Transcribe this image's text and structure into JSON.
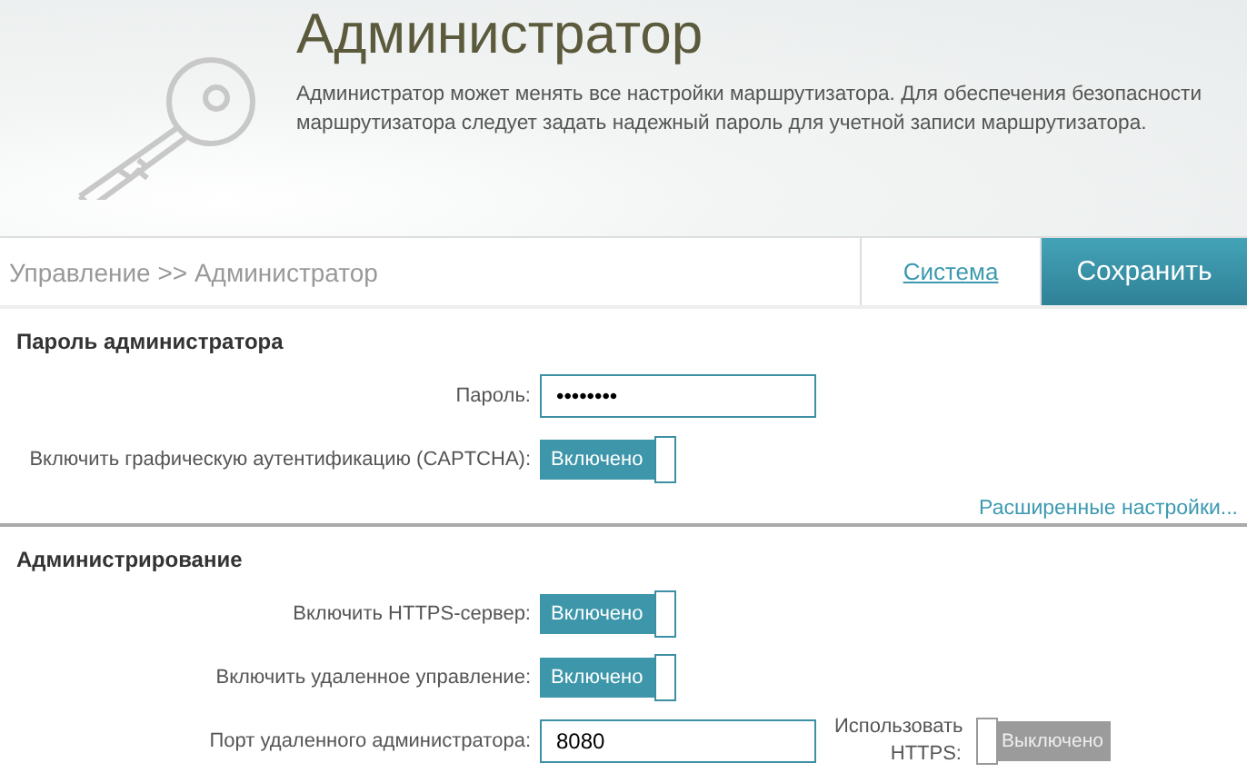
{
  "header": {
    "title": "Администратор",
    "description": "Администратор может менять все настройки маршрутизатора. Для обеспечения безопасности маршрутизатора следует задать надежный пароль для учетной записи маршрутизатора."
  },
  "toolbar": {
    "breadcrumb": "Управление >> Администратор",
    "link": "Система",
    "save_button": "Сохранить"
  },
  "sections": [
    {
      "title": "Пароль администратора",
      "rows": [
        {
          "kind": "password",
          "label": "Пароль:",
          "value": "••••••••"
        },
        {
          "kind": "toggle",
          "label": "Включить графическую аутентификацию (CAPTCHA):",
          "toggle": {
            "on": true,
            "text": "Включено"
          }
        }
      ],
      "link": "Расширенные настройки..."
    },
    {
      "title": "Администрирование",
      "rows": [
        {
          "kind": "toggle",
          "label": "Включить HTTPS-сервер:",
          "toggle": {
            "on": true,
            "text": "Включено"
          }
        },
        {
          "kind": "toggle",
          "label": "Включить удаленное управление:",
          "toggle": {
            "on": true,
            "text": "Включено"
          }
        },
        {
          "kind": "port",
          "label": "Порт удаленного администратора:",
          "value": "8080",
          "extra_label": "Использовать HTTPS:",
          "toggle": {
            "on": false,
            "text": "Выключено"
          }
        }
      ]
    }
  ]
}
